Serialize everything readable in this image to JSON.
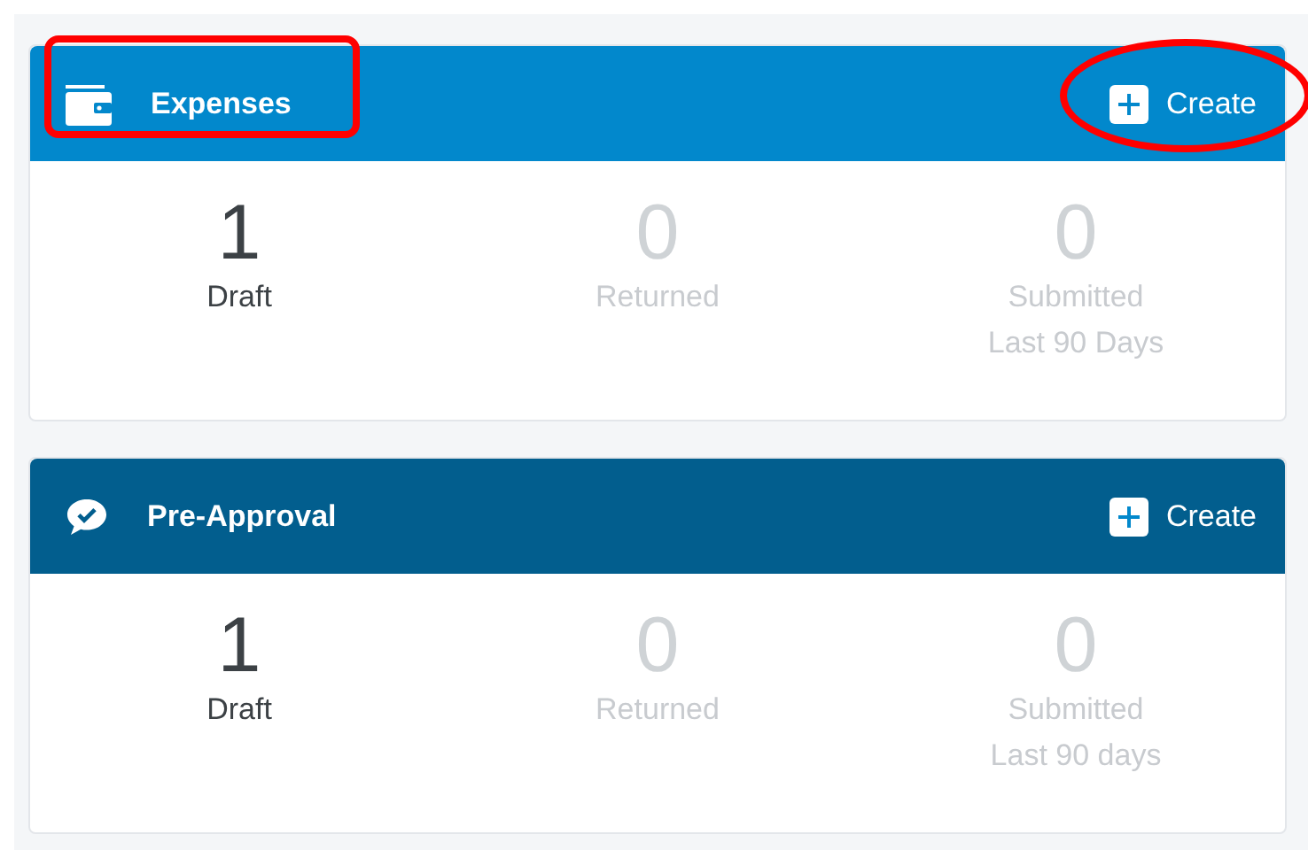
{
  "cards": [
    {
      "kind": "wallet",
      "title": "Expenses",
      "color": "#0288cc",
      "title_highlighted": true,
      "create": {
        "label": "Create",
        "highlighted": true
      },
      "stats": [
        {
          "value": "1",
          "label": "Draft",
          "muted": false
        },
        {
          "value": "0",
          "label": "Returned",
          "muted": true
        },
        {
          "value": "0",
          "label": "Submitted",
          "sublabel": "Last 90 Days",
          "muted": true
        }
      ]
    },
    {
      "kind": "approval",
      "title": "Pre-Approval",
      "color": "#025e8e",
      "title_highlighted": false,
      "create": {
        "label": "Create",
        "highlighted": false
      },
      "stats": [
        {
          "value": "1",
          "label": "Draft",
          "muted": false
        },
        {
          "value": "0",
          "label": "Returned",
          "muted": true
        },
        {
          "value": "0",
          "label": "Submitted",
          "sublabel": "Last 90 days",
          "muted": true
        }
      ]
    }
  ]
}
